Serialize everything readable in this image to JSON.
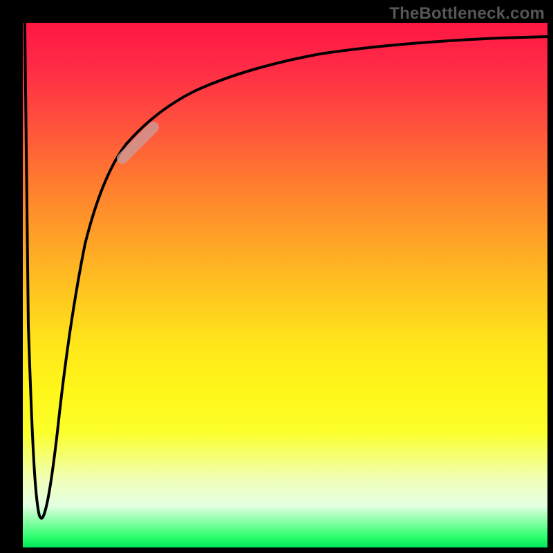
{
  "watermark": "TheBottleneck.com",
  "colors": {
    "gradient_top": "#ff1744",
    "gradient_mid_orange": "#ffa526",
    "gradient_mid_yellow": "#fff61a",
    "gradient_bottom": "#00e85a",
    "frame": "#000000",
    "curve": "#000000",
    "highlight": "#c8a0a0"
  },
  "chart_data": {
    "type": "line",
    "title": "",
    "xlabel": "",
    "ylabel": "",
    "xlim": [
      0,
      100
    ],
    "ylim": [
      0,
      100
    ],
    "series": [
      {
        "name": "curve",
        "x": [
          0.2,
          0.8,
          1.6,
          2.6,
          3.4,
          4.0,
          4.6,
          5.4,
          6.6,
          8.0,
          10.0,
          12.5,
          15.5,
          19.0,
          23.0,
          28.0,
          34.0,
          41.0,
          50.0,
          60.0,
          72.0,
          85.0,
          100.0
        ],
        "values": [
          100,
          58,
          18,
          6,
          6.5,
          12,
          22,
          36,
          50,
          60,
          68,
          74,
          78,
          82,
          85,
          88,
          90.5,
          92.5,
          94,
          95,
          95.8,
          96.5,
          97
        ]
      }
    ],
    "highlight_segment": {
      "description": "pale translucent band on the rising curve",
      "x_range": [
        19,
        25
      ],
      "y_range": [
        74,
        80
      ]
    }
  }
}
